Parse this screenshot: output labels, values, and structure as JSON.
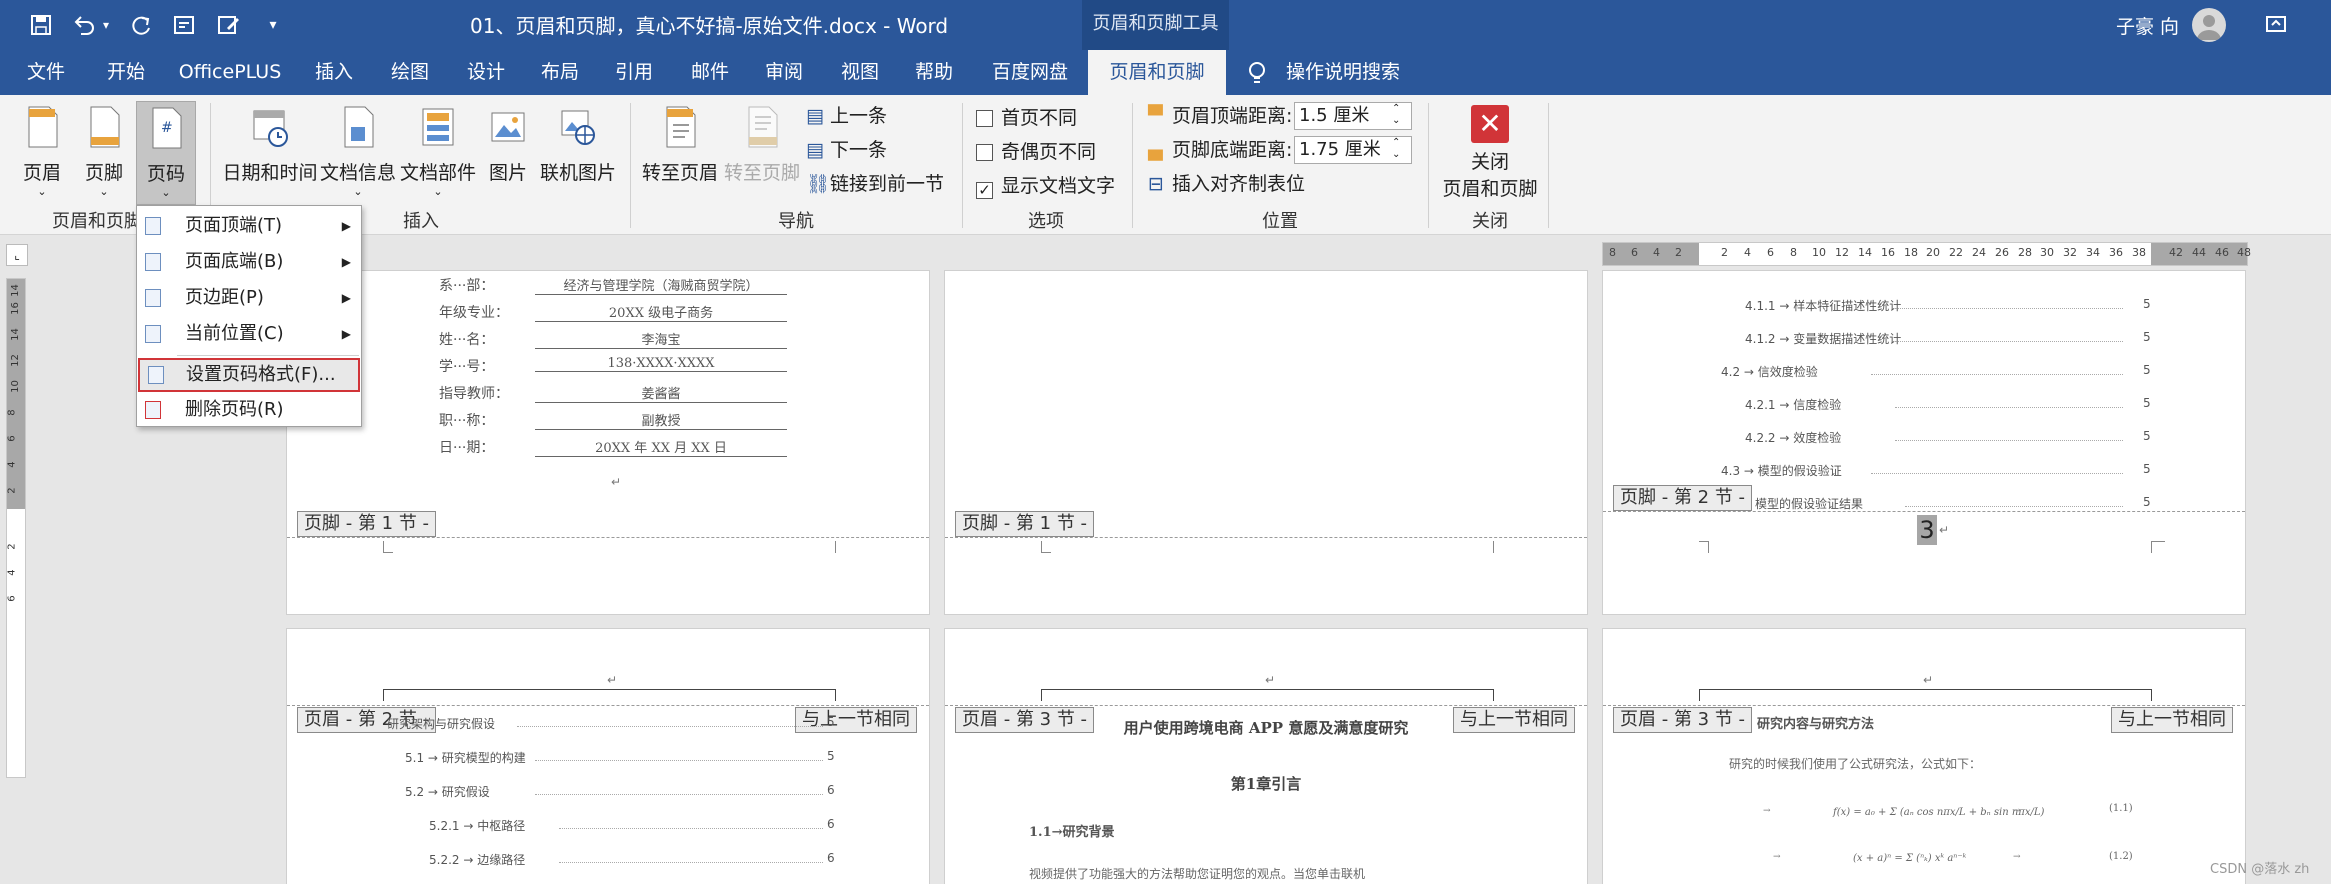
{
  "title": {
    "doc_title": "01、页眉和页脚，真心不好搞-原始文件.docx  -  Word",
    "context_tool": "页眉和页脚工具",
    "user": "子豪 向"
  },
  "tabs": [
    "文件",
    "开始",
    "OfficePLUS",
    "插入",
    "绘图",
    "设计",
    "布局",
    "引用",
    "邮件",
    "审阅",
    "视图",
    "帮助",
    "百度网盘",
    "页眉和页脚"
  ],
  "tell_me": "操作说明搜索",
  "ribbon": {
    "header_btn": "页眉",
    "footer_btn": "页脚",
    "pagenum_btn": "页码",
    "group_hf_label": "页眉和页脚",
    "datetime_btn": "日期和时间",
    "docinfo_btn": "文档信息",
    "docparts_btn": "文档部件",
    "picture_btn": "图片",
    "online_pic_btn": "联机图片",
    "group_insert_label": "插入",
    "goto_header_btn": "转至页眉",
    "goto_footer_btn": "转至页脚",
    "prev_btn": "上一条",
    "next_btn": "下一条",
    "link_prev_btn": "链接到前一节",
    "group_nav_label": "导航",
    "opt_first": "首页不同",
    "opt_oddeven": "奇偶页不同",
    "opt_showtext": "显示文档文字",
    "group_options_label": "选项",
    "header_dist_label": "页眉顶端距离:",
    "header_dist_value": "1.5 厘米",
    "footer_dist_label": "页脚底端距离:",
    "footer_dist_value": "1.75 厘米",
    "align_tab_btn": "插入对齐制表位",
    "group_pos_label": "位置",
    "close_btn_line1": "关闭",
    "close_btn_line2": "页眉和页脚",
    "group_close_label": "关闭"
  },
  "menu": {
    "items": [
      "页面顶端(T)",
      "页面底端(B)",
      "页边距(P)",
      "当前位置(C)",
      "设置页码格式(F)...",
      "删除页码(R)"
    ]
  },
  "ruler_numbers": [
    "8",
    "6",
    "4",
    "2",
    "2",
    "4",
    "6",
    "8",
    "10",
    "12",
    "14",
    "16",
    "18",
    "20",
    "22",
    "24",
    "26",
    "28",
    "30",
    "32",
    "34",
    "36",
    "38",
    "42",
    "44",
    "46",
    "48"
  ],
  "vruler_numbers": [
    "14",
    "16",
    "14",
    "12",
    "10",
    "8",
    "6",
    "4",
    "2",
    "2",
    "4",
    "6"
  ],
  "page1": {
    "rows": [
      {
        "label": "系···部：",
        "value": "经济与管理学院（海贼商贸学院）"
      },
      {
        "label": "年级专业：",
        "value": "20XX 级电子商务"
      },
      {
        "label": "姓···名：",
        "value": "李海宝"
      },
      {
        "label": "学···号：",
        "value": "138·XXXX·XXXX"
      },
      {
        "label": "指导教师：",
        "value": "姜酱酱"
      },
      {
        "label": "职···称：",
        "value": "副教授"
      },
      {
        "label": "日···期：",
        "value": "20XX 年 XX 月 XX 日"
      }
    ],
    "footer_tag": "页脚 - 第 1 节 -"
  },
  "page2": {
    "footer_tag": "页脚 - 第 1 节 -"
  },
  "page3": {
    "toc": [
      {
        "t": "4.1.1 → 样本特征描述性统计",
        "p": "5"
      },
      {
        "t": "4.1.2 → 变量数据描述性统计",
        "p": "5"
      },
      {
        "t": "4.2 → 信效度检验",
        "p": "5"
      },
      {
        "t": "4.2.1 → 信度检验",
        "p": "5"
      },
      {
        "t": "4.2.2 → 效度检验",
        "p": "5"
      },
      {
        "t": "4.3 → 模型的假设验证",
        "p": "5"
      },
      {
        "t": "模型的假设验证结果",
        "p": "5"
      }
    ],
    "footer_tag": "页脚 - 第 2 节 -",
    "page_number": "3"
  },
  "page4": {
    "header_tag": "页眉 - 第 2 节 -",
    "same_tag": "与上一节相同",
    "toc": [
      {
        "t": "研究架构与研究假设",
        "p": "5"
      },
      {
        "t": "5.1 → 研究模型的构建",
        "p": "5"
      },
      {
        "t": "5.2 → 研究假设",
        "p": "6"
      },
      {
        "t": "5.2.1 → 中枢路径",
        "p": "6"
      },
      {
        "t": "5.2.2 → 边缘路径",
        "p": "6"
      }
    ]
  },
  "page5": {
    "header_tag": "页眉 - 第 3 节 -",
    "same_tag": "与上一节相同",
    "title": "用户使用跨境电商 APP 意愿及满意度研究",
    "chapter": "第1章引言",
    "section": "1.1→研究背景",
    "body": "视频提供了功能强大的方法帮助您证明您的观点。当您单击联机"
  },
  "page6": {
    "header_tag": "页眉 - 第 3 节 -",
    "same_tag": "与上一节相同",
    "heading": "研究内容与研究方法",
    "body": "研究的时候我们使用了公式研究法，公式如下：",
    "eq1_num": "(1.1)",
    "eq2_num": "(1.2)"
  },
  "watermark": "CSDN @落水 zh"
}
